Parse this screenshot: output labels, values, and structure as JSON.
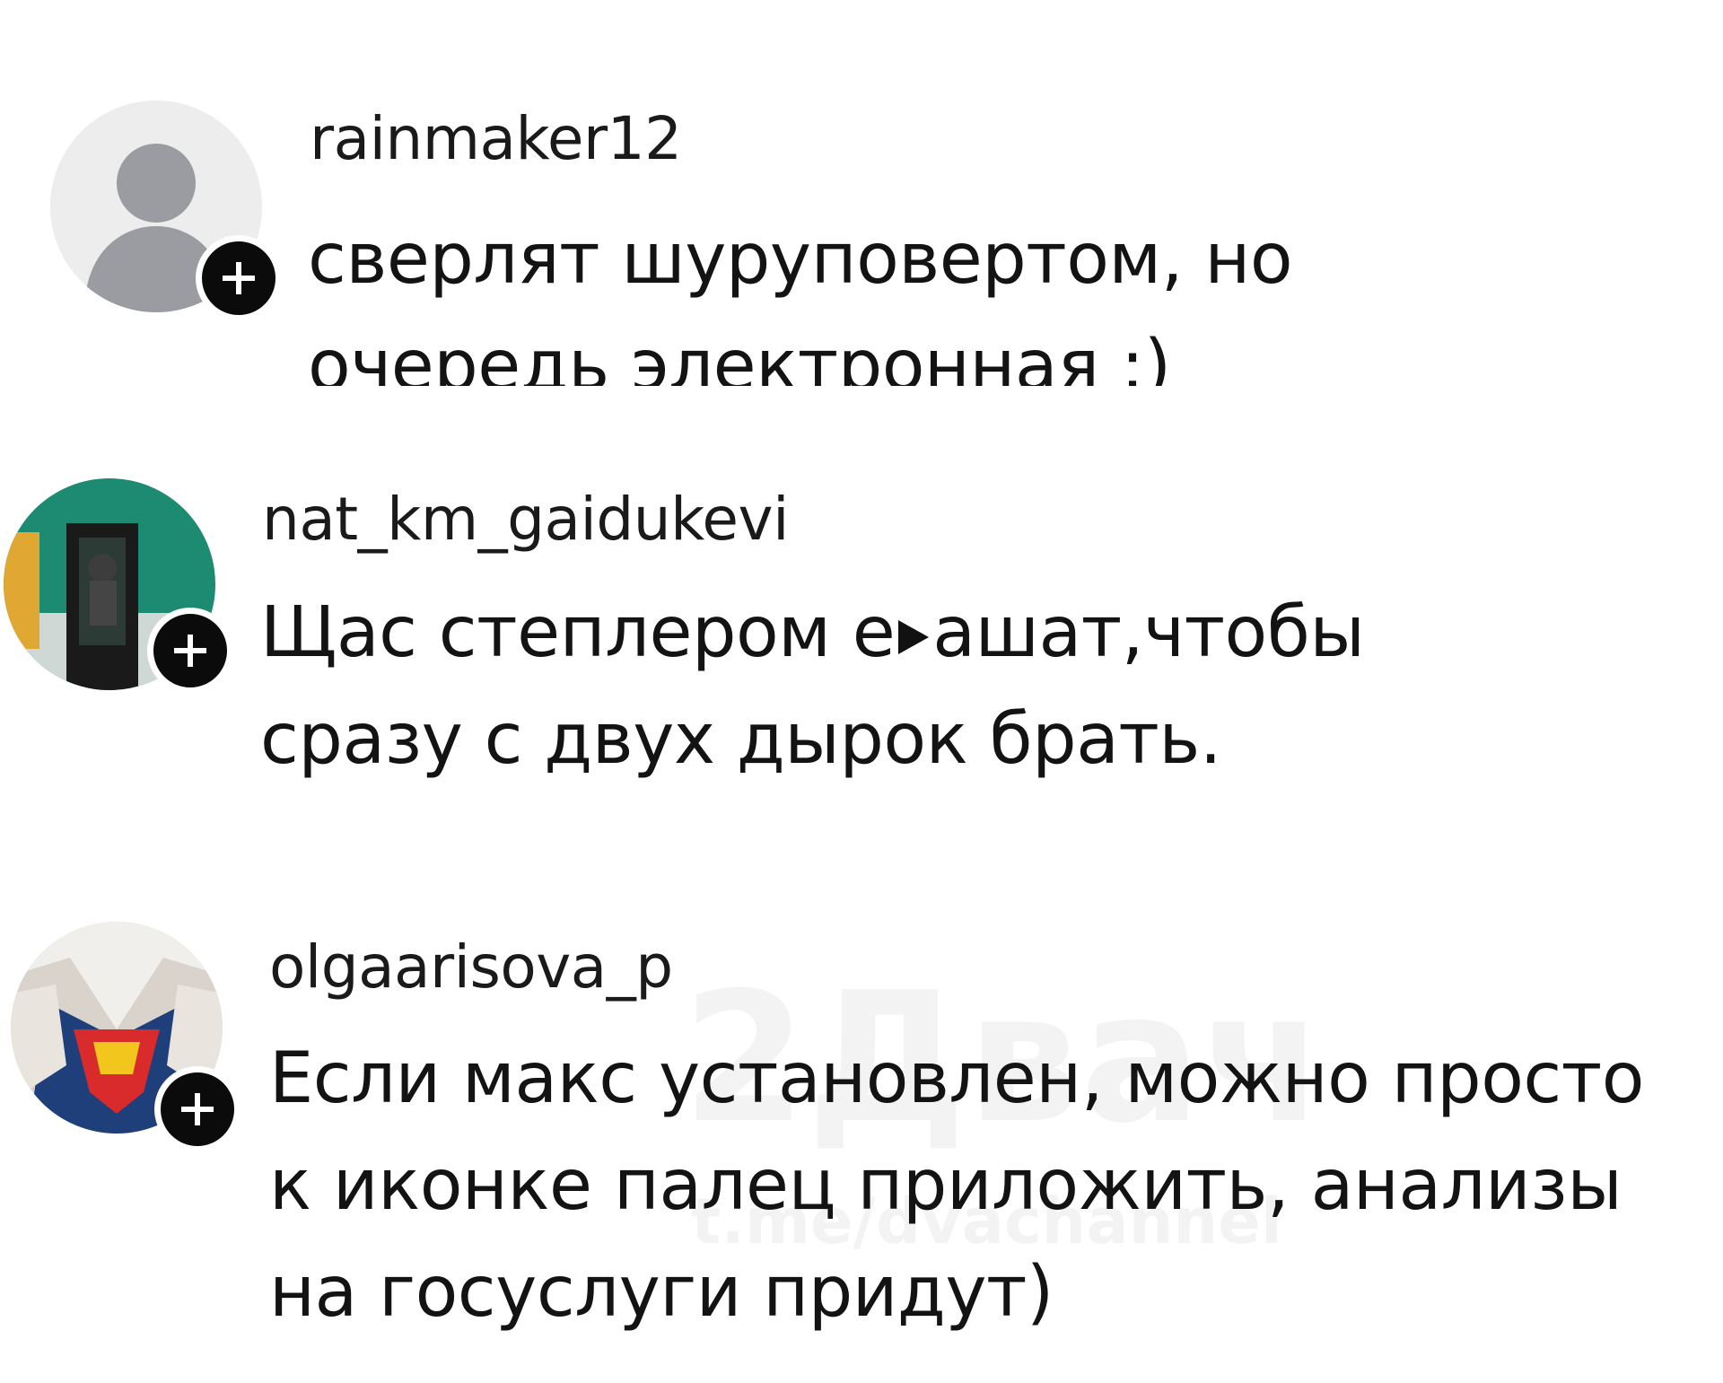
{
  "comments": [
    {
      "username": "rainmaker12",
      "text": "сверлят шуруповертом, но очередь электронная :)",
      "avatar_icon": "default-user-avatar-icon",
      "follow_icon": "plus-icon"
    },
    {
      "username": "nat_km_gaidukevi",
      "text_before": "Щас степлером е",
      "text_after": "ашат,чтобы сразу с двух дырок брать.",
      "avatar_icon": "photo-avatar",
      "follow_icon": "plus-icon"
    },
    {
      "username": "olgaarisova_p",
      "text": "Если макс  установлен, можно просто к иконке палец приложить, анализы на госуслуги придут)",
      "avatar_icon": "superman-photo-avatar",
      "follow_icon": "plus-icon"
    }
  ],
  "watermark": {
    "text": "2Двач",
    "sub": "t.me/dvachannel"
  },
  "colors": {
    "follow_button": "#0b0b0b",
    "default_avatar_bg": "#ededed",
    "default_avatar_fg": "#9a9ca1",
    "teal_wall": "#1d8a72"
  }
}
